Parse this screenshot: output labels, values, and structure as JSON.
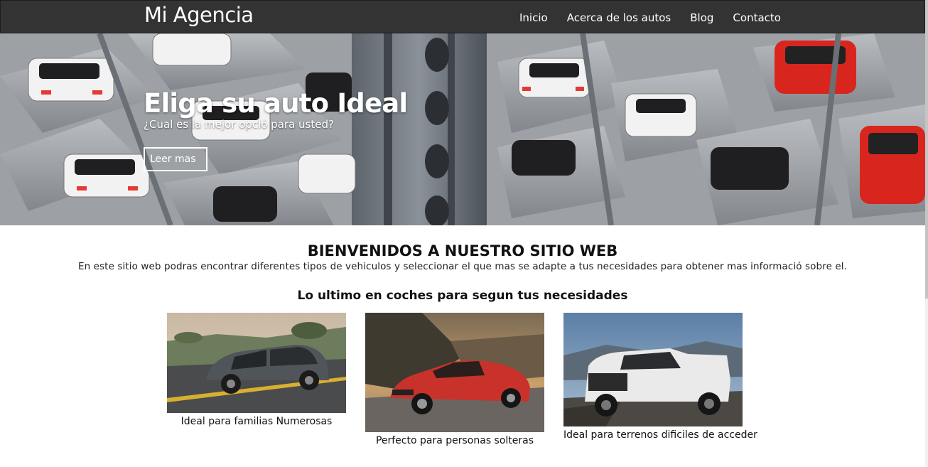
{
  "header": {
    "brand": "Mi Agencia",
    "nav": [
      "Inicio",
      "Acerca de los autos",
      "Blog",
      "Contacto"
    ]
  },
  "hero": {
    "title": "Eliga su auto Ideal",
    "subtitle": "¿Cual es la mejor opció para usted?",
    "button": "Leer mas"
  },
  "welcome": {
    "title": "BIENVENIDOS A NUESTRO SITIO WEB",
    "text": "En este sitio web podras encontrar diferentes tipos de vehiculos y seleccionar el que mas se adapte a tus necesidades para obtener mas informació sobre el."
  },
  "latest": {
    "title": "Lo ultimo en coches para segun tus necesidades",
    "cards": [
      {
        "caption": "Ideal para familias Numerosas",
        "image": "gray-minivan-image"
      },
      {
        "caption": "Perfecto para personas solteras",
        "image": "red-sedan-image"
      },
      {
        "caption": "Ideal para terrenos dificiles de acceder",
        "image": "white-pickup-truck-image"
      }
    ]
  },
  "colors": {
    "header_bg": "#333333",
    "text_on_dark": "#ffffff"
  }
}
